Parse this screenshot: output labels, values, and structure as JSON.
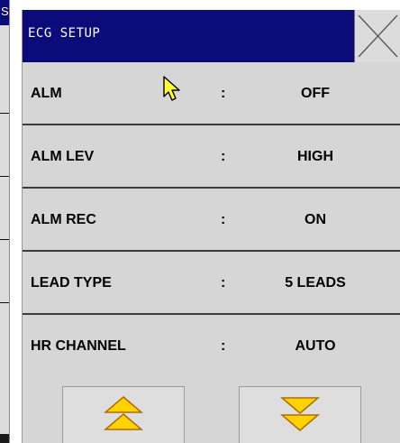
{
  "background_window": {
    "title_fragment": "S"
  },
  "dialog": {
    "title": "ECG SETUP",
    "close_icon": "close-x-icon"
  },
  "rows": [
    {
      "label": "ALM",
      "separator": ":",
      "value": "OFF"
    },
    {
      "label": "ALM LEV",
      "separator": ":",
      "value": "HIGH"
    },
    {
      "label": "ALM REC",
      "separator": ":",
      "value": "ON"
    },
    {
      "label": "LEAD TYPE",
      "separator": ":",
      "value": "5 LEADS"
    },
    {
      "label": "HR CHANNEL",
      "separator": ":",
      "value": "AUTO"
    }
  ],
  "navigation": {
    "up_icon": "double-chevron-up-icon",
    "down_icon": "double-chevron-down-icon"
  },
  "colors": {
    "titlebar": "#0b0b7a",
    "dialog_bg": "#d6d6d6",
    "arrow_fill": "#ffd200",
    "arrow_stroke": "#b06a00",
    "cursor_fill": "#ffff33"
  }
}
